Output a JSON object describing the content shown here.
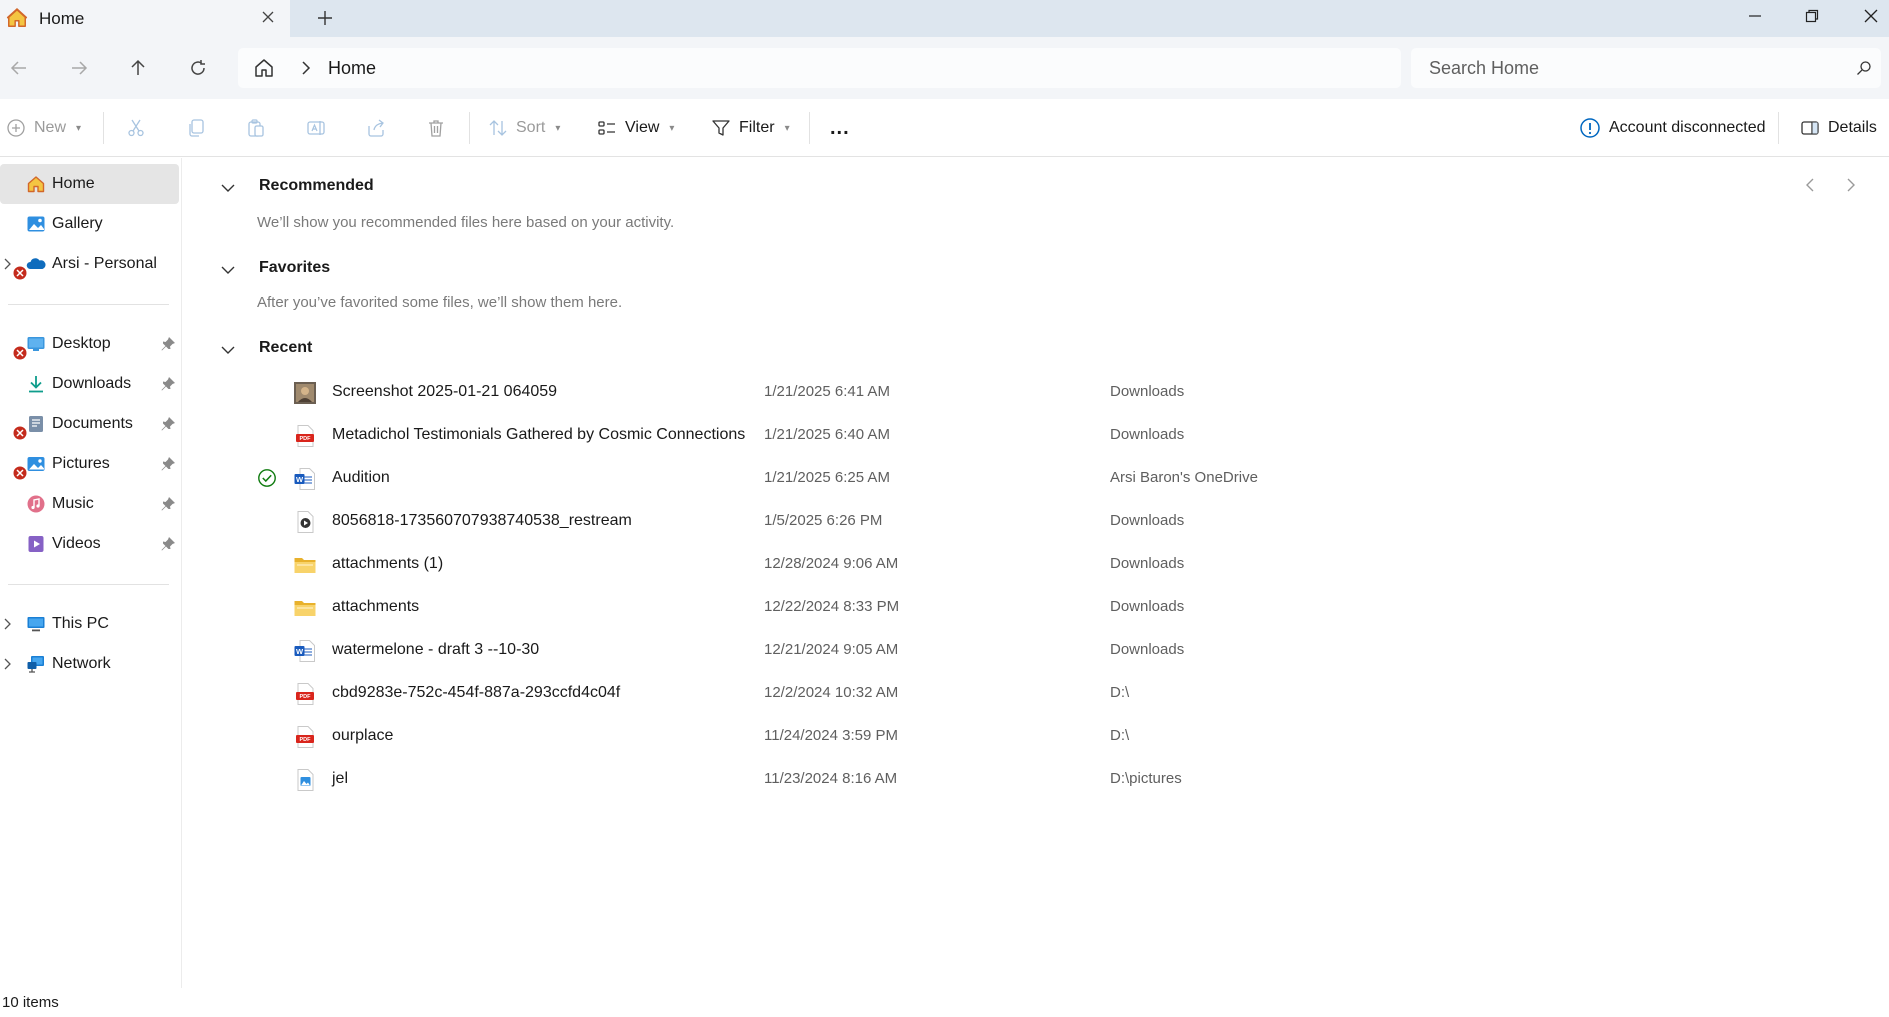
{
  "window": {
    "tab_title": "Home",
    "tab_icon": "home-icon",
    "controls": [
      "minimize-icon",
      "restore-icon",
      "close-icon"
    ]
  },
  "navigation": {
    "breadcrumb": [
      "Home"
    ],
    "search_placeholder": "Search Home"
  },
  "toolbar": {
    "new_label": "New",
    "sort_label": "Sort",
    "view_label": "View",
    "filter_label": "Filter",
    "more_label": "...",
    "account_status": "Account disconnected",
    "details_label": "Details"
  },
  "sidebar": {
    "items": [
      {
        "label": "Home",
        "icon": "home-icon",
        "selected": true
      },
      {
        "label": "Gallery",
        "icon": "gallery-icon"
      },
      {
        "label": "Arsi - Personal",
        "icon": "onedrive-cloud-icon",
        "expandable": true,
        "error": true
      },
      {
        "label": "Desktop",
        "icon": "desktop-folder-icon",
        "pinned": true,
        "error": true
      },
      {
        "label": "Downloads",
        "icon": "download-arrow-icon",
        "pinned": true
      },
      {
        "label": "Documents",
        "icon": "documents-folder-icon",
        "pinned": true,
        "error": true
      },
      {
        "label": "Pictures",
        "icon": "pictures-folder-icon",
        "pinned": true,
        "error": true
      },
      {
        "label": "Music",
        "icon": "music-icon",
        "pinned": true
      },
      {
        "label": "Videos",
        "icon": "videos-icon",
        "pinned": true
      },
      {
        "label": "This PC",
        "icon": "computer-icon",
        "expandable": true
      },
      {
        "label": "Network",
        "icon": "network-icon",
        "expandable": true
      }
    ]
  },
  "sections": {
    "recommended": {
      "title": "Recommended",
      "description": "We’ll show you recommended files here based on your activity."
    },
    "favorites": {
      "title": "Favorites",
      "description": "After you’ve favorited some files, we’ll show them here."
    },
    "recent": {
      "title": "Recent",
      "files": [
        {
          "name": "Screenshot 2025-01-21 064059",
          "date": "1/21/2025 6:41 AM",
          "location": "Downloads",
          "icon": "image-thumbnail-icon"
        },
        {
          "name": "Metadichol Testimonials Gathered by Cosmic Connections",
          "date": "1/21/2025 6:40 AM",
          "location": "Downloads",
          "icon": "pdf-file-icon"
        },
        {
          "name": "Audition",
          "date": "1/21/2025 6:25 AM",
          "location": "Arsi Baron's OneDrive",
          "icon": "word-file-icon",
          "synced": true
        },
        {
          "name": "8056818-173560707938740538_restream",
          "date": "1/5/2025 6:26 PM",
          "location": "Downloads",
          "icon": "video-file-icon"
        },
        {
          "name": "attachments (1)",
          "date": "12/28/2024 9:06 AM",
          "location": "Downloads",
          "icon": "folder-icon"
        },
        {
          "name": "attachments",
          "date": "12/22/2024 8:33 PM",
          "location": "Downloads",
          "icon": "folder-icon"
        },
        {
          "name": "watermelone  - draft 3 --10-30",
          "date": "12/21/2024 9:05 AM",
          "location": "Downloads",
          "icon": "word-file-icon"
        },
        {
          "name": "cbd9283e-752c-454f-887a-293ccfd4c04f",
          "date": "12/2/2024 10:32 AM",
          "location": "D:\\",
          "icon": "pdf-file-icon"
        },
        {
          "name": "ourplace",
          "date": "11/24/2024 3:59 PM",
          "location": "D:\\",
          "icon": "pdf-file-icon"
        },
        {
          "name": "jel",
          "date": "11/23/2024 8:16 AM",
          "location": "D:\\pictures",
          "icon": "image-file-icon"
        }
      ]
    }
  },
  "status": {
    "item_count": "10 items"
  },
  "colors": {
    "accent": "#0067c0",
    "error": "#c42b1c",
    "success": "#0f7b0f",
    "folder": "#f4c542",
    "pdf": "#d9251c",
    "word": "#185abd"
  }
}
